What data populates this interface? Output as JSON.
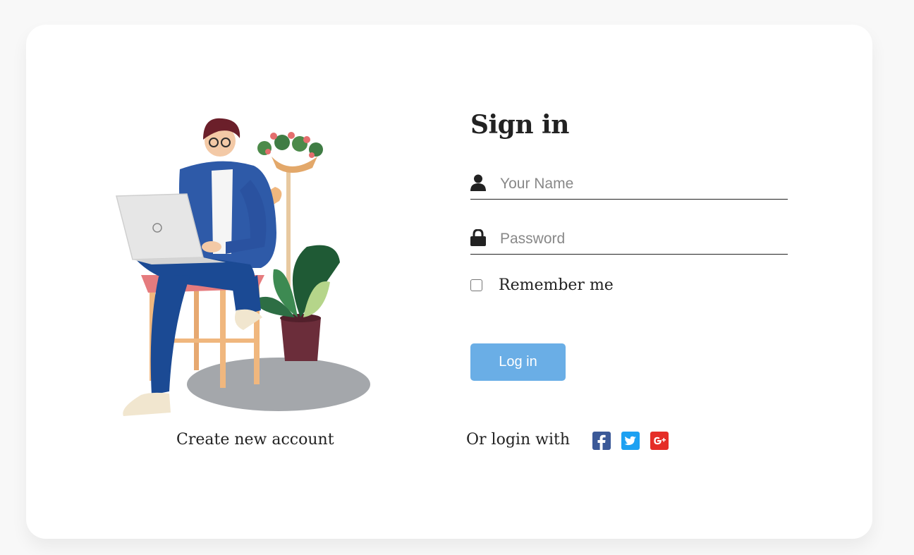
{
  "illustration": {
    "alt": "person with laptop on chair"
  },
  "signin": {
    "title": "Sign in",
    "name_placeholder": "Your Name",
    "password_placeholder": "Password",
    "remember_label": "Remember me",
    "login_label": "Log in",
    "create_account": "Create new account",
    "or_login_with": "Or login with"
  },
  "icons": {
    "user": "user-icon",
    "lock": "lock-icon",
    "facebook": "facebook-icon",
    "twitter": "twitter-icon",
    "google": "google-plus-icon"
  },
  "colors": {
    "page_bg": "#f8f8f8",
    "card_bg": "#ffffff",
    "button": "#6aaee6",
    "facebook": "#3b5998",
    "twitter": "#1da1f2",
    "google": "#e52d27"
  }
}
